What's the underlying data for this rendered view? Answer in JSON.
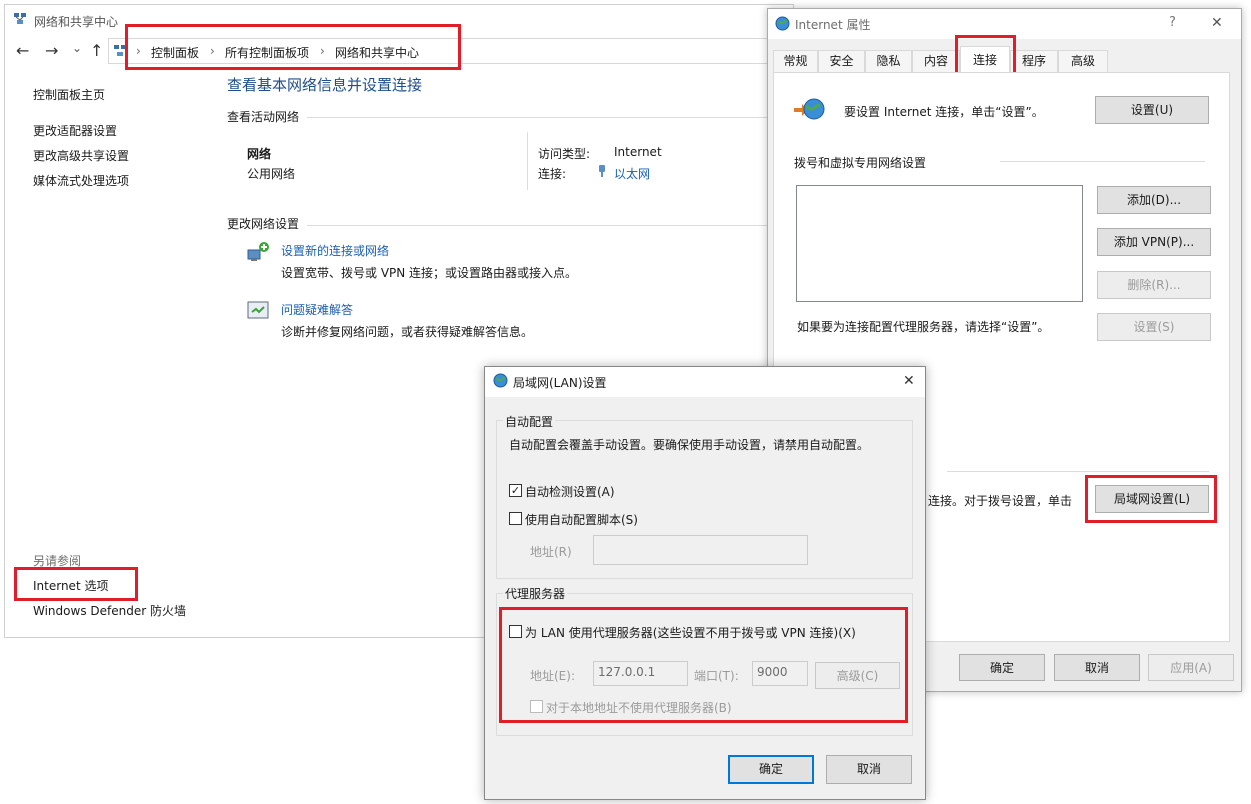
{
  "explorer": {
    "title": "网络和共享中心",
    "breadcrumb": [
      "控制面板",
      "所有控制面板项",
      "网络和共享中心"
    ],
    "nav": {
      "back": "←",
      "forward": "→",
      "recent": "⌄",
      "up": "↑"
    },
    "sidebar": {
      "items": [
        "控制面板主页",
        "更改适配器设置",
        "更改高级共享设置",
        "媒体流式处理选项"
      ],
      "see_also_label": "另请参阅",
      "see_also": [
        "Internet 选项",
        "Windows Defender 防火墙"
      ]
    },
    "main": {
      "heading": "查看基本网络信息并设置连接",
      "active_networks_label": "查看活动网络",
      "network_name": "网络",
      "network_type": "公用网络",
      "access_type_label": "访问类型:",
      "access_type_value": "Internet",
      "connection_label": "连接:",
      "connection_value": "以太网",
      "change_settings_label": "更改网络设置",
      "tasks": [
        {
          "title": "设置新的连接或网络",
          "desc": "设置宽带、拨号或 VPN 连接；或设置路由器或接入点。"
        },
        {
          "title": "问题疑难解答",
          "desc": "诊断并修复网络问题，或者获得疑难解答信息。"
        }
      ]
    }
  },
  "inet_props": {
    "title": "Internet 属性",
    "help": "?",
    "close": "✕",
    "tabs": [
      "常规",
      "安全",
      "隐私",
      "内容",
      "连接",
      "程序",
      "高级"
    ],
    "active_tab": "连接",
    "setup_text": "要设置 Internet 连接，单击“设置”。",
    "setup_button": "设置(U)",
    "dialup_label": "拨号和虚拟专用网络设置",
    "add_button": "添加(D)...",
    "add_vpn_button": "添加 VPN(P)...",
    "remove_button": "删除(R)...",
    "settings_button": "设置(S)",
    "proxy_hint": "如果要为连接配置代理服务器，请选择“设置”。",
    "lan_partial_text": "连接。对于拨号设置，单击",
    "lan_button": "局域网设置(L)",
    "ok": "确定",
    "cancel": "取消",
    "apply": "应用(A)"
  },
  "lan_dialog": {
    "title": "局域网(LAN)设置",
    "close": "✕",
    "auto_group": "自动配置",
    "auto_desc": "自动配置会覆盖手动设置。要确保使用手动设置，请禁用自动配置。",
    "auto_detect": {
      "label": "自动检测设置(A)",
      "checked": true
    },
    "auto_script": {
      "label": "使用自动配置脚本(S)",
      "checked": false
    },
    "address_label": "地址(R)",
    "proxy_group": "代理服务器",
    "use_proxy": {
      "label": "为 LAN 使用代理服务器(这些设置不用于拨号或 VPN 连接)(X)",
      "checked": false
    },
    "proxy_address_label": "地址(E):",
    "proxy_address_value": "127.0.0.1",
    "port_label": "端口(T):",
    "port_value": "9000",
    "advanced_button": "高级(C)",
    "bypass_local": {
      "label": "对于本地地址不使用代理服务器(B)",
      "checked": false
    },
    "ok": "确定",
    "cancel": "取消"
  },
  "colors": {
    "highlight": "#e01e2a",
    "link": "#1a5fb4",
    "accent": "#0078d7"
  }
}
